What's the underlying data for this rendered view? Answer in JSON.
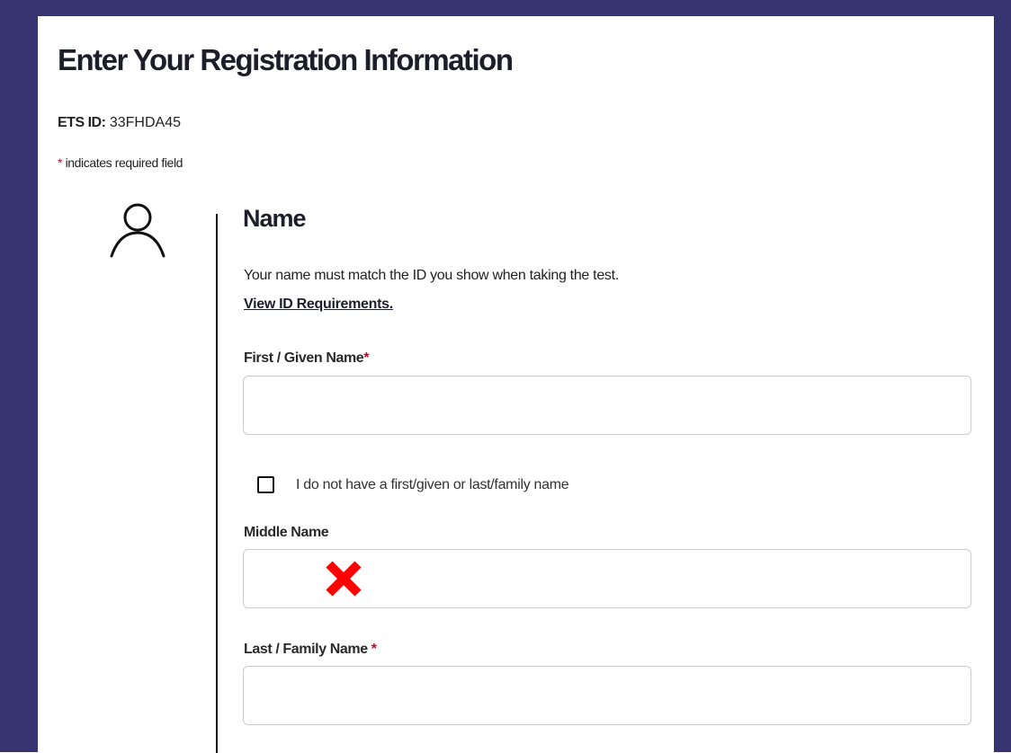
{
  "page": {
    "title": "Enter Your Registration Information",
    "ets_id_label": "ETS ID:",
    "ets_id_value": "33FHDA45",
    "required_asterisk": "*",
    "required_note": "indicates required field"
  },
  "name_section": {
    "icon": "person-icon",
    "title": "Name",
    "description": "Your name must match the ID you show when taking the test.",
    "link_label": "View ID Requirements.",
    "first_name": {
      "label": "First / Given Name",
      "required_mark": "*",
      "value": ""
    },
    "no_name_checkbox": {
      "label": "I do not have a first/given or last/family name",
      "checked": false
    },
    "middle_name": {
      "label": "Middle Name",
      "value": "",
      "overlay_icon": "red-x-icon"
    },
    "last_name": {
      "label": "Last / Family Name",
      "required_mark": "*",
      "value": ""
    }
  },
  "colors": {
    "frame": "#353470",
    "required": "#b0142b",
    "overlay_x": "#ff0000",
    "input_border": "#c9cbd3"
  }
}
